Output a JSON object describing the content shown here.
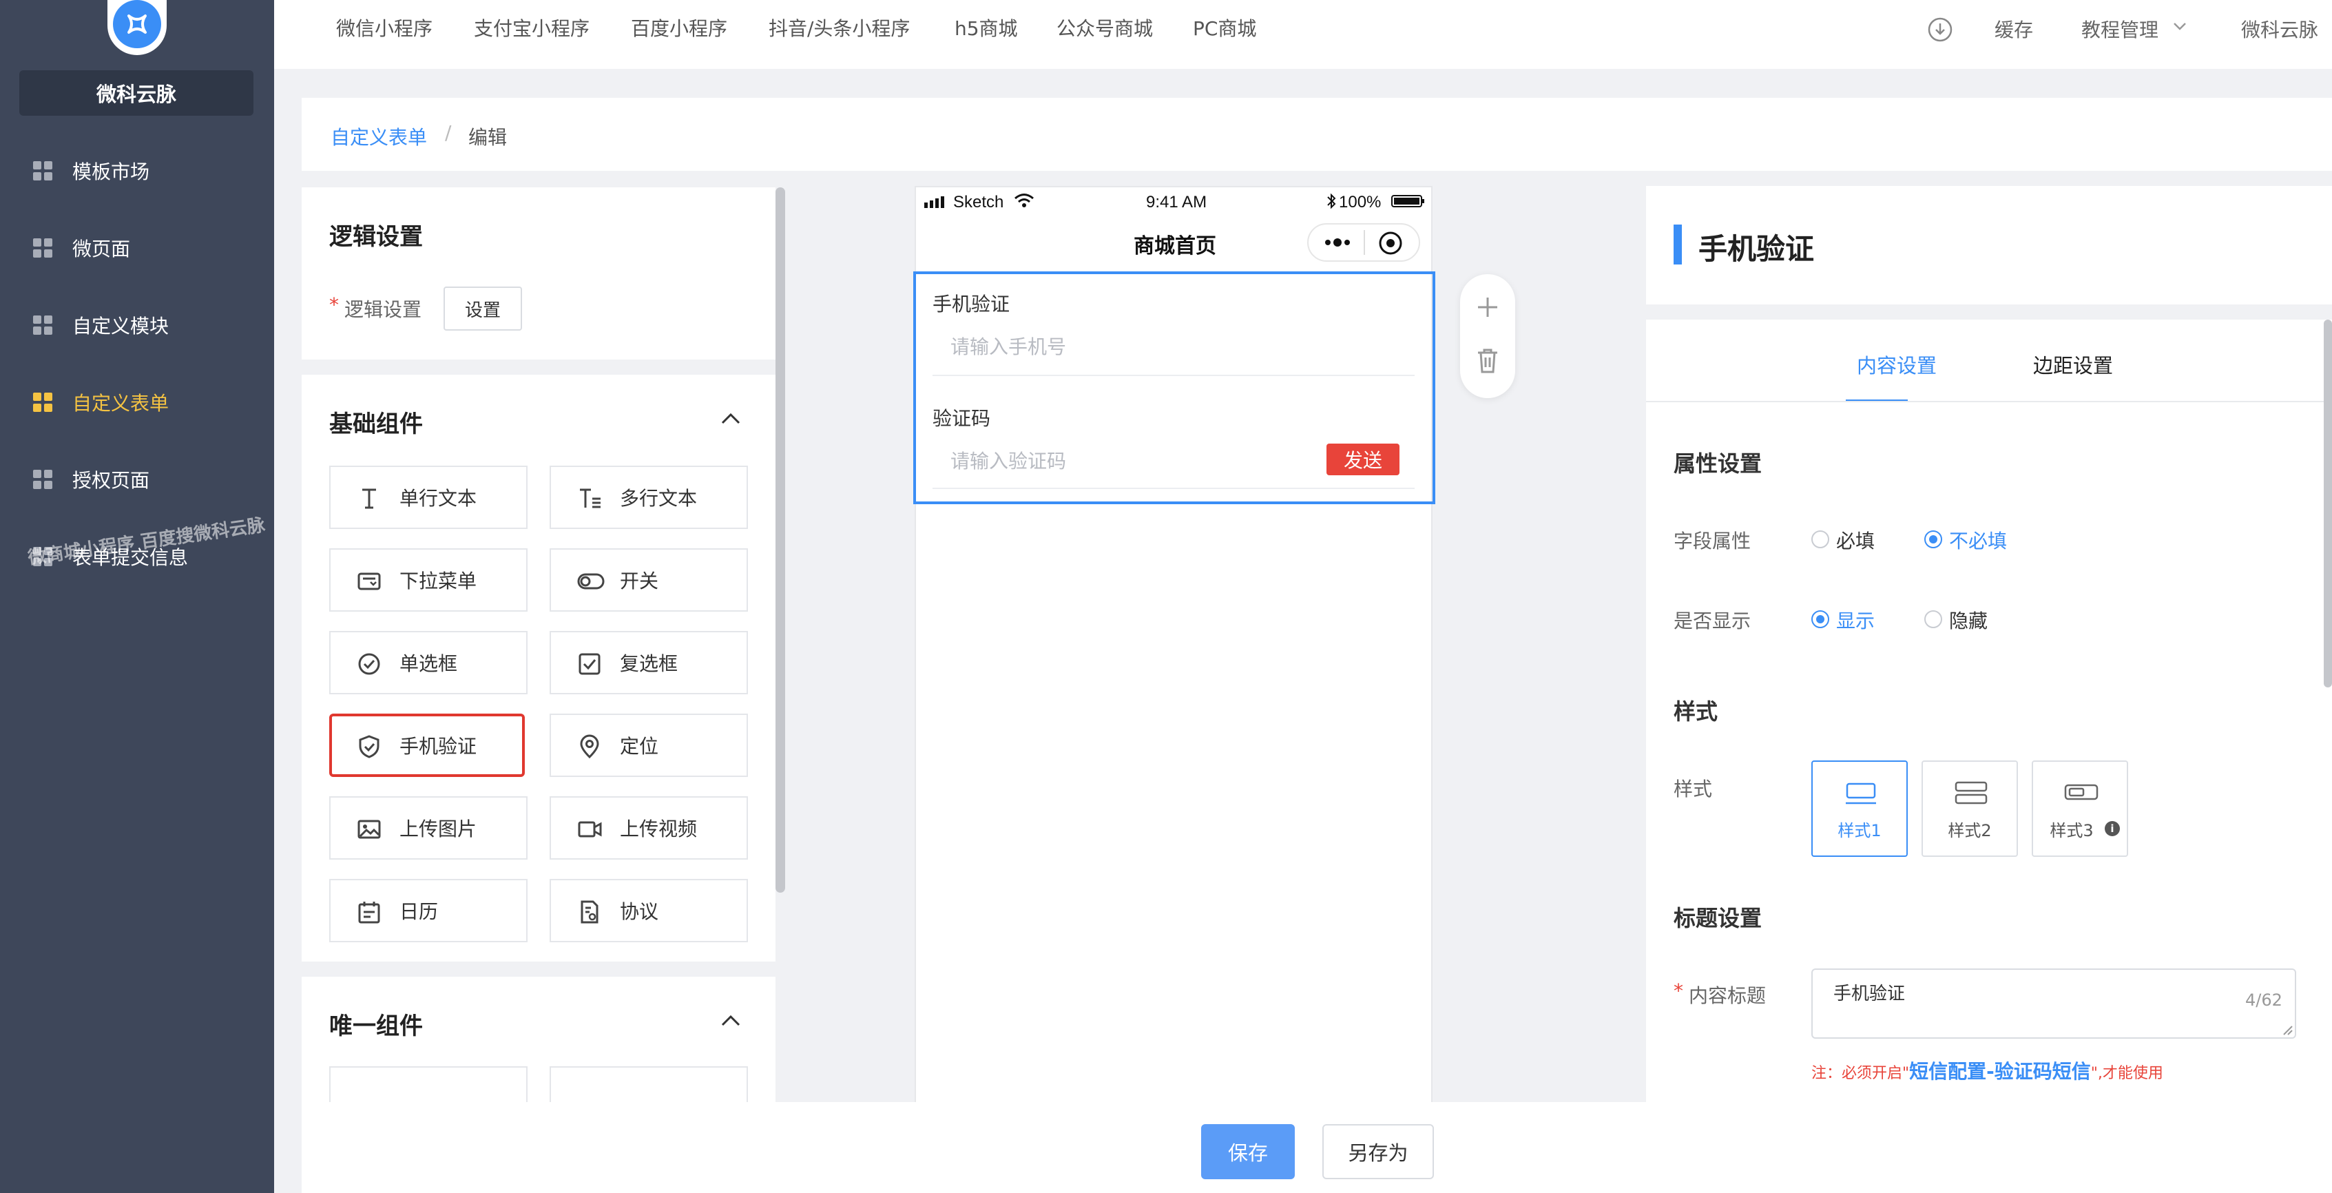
{
  "sidebar": {
    "brand": "微科云脉",
    "items": [
      {
        "label": "模板市场"
      },
      {
        "label": "微页面"
      },
      {
        "label": "自定义模块"
      },
      {
        "label": "自定义表单"
      },
      {
        "label": "授权页面"
      },
      {
        "label": "表单提交信息"
      }
    ],
    "active_index": 3,
    "watermark": "微商城小程序 百度搜微科云脉"
  },
  "topbar": {
    "nav": [
      "微信小程序",
      "支付宝小程序",
      "百度小程序",
      "抖音/头条小程序",
      "h5商城",
      "公众号商城",
      "PC商城"
    ],
    "cache": "缓存",
    "tutorial": "教程管理",
    "user": "微科云脉"
  },
  "breadcrumb": {
    "parent": "自定义表单",
    "separator": "/",
    "current": "编辑"
  },
  "logic": {
    "title": "逻辑设置",
    "required_mark": "*",
    "label": "逻辑设置",
    "button": "设置"
  },
  "basic_components": {
    "title": "基础组件",
    "items": [
      {
        "label": "单行文本",
        "icon": "text-cursor-icon"
      },
      {
        "label": "多行文本",
        "icon": "multiline-text-icon"
      },
      {
        "label": "下拉菜单",
        "icon": "dropdown-icon"
      },
      {
        "label": "开关",
        "icon": "toggle-icon"
      },
      {
        "label": "单选框",
        "icon": "radio-icon"
      },
      {
        "label": "复选框",
        "icon": "checkbox-icon"
      },
      {
        "label": "手机验证",
        "icon": "shield-icon"
      },
      {
        "label": "定位",
        "icon": "location-pin-icon"
      },
      {
        "label": "上传图片",
        "icon": "image-icon"
      },
      {
        "label": "上传视频",
        "icon": "video-icon"
      },
      {
        "label": "日历",
        "icon": "calendar-icon"
      },
      {
        "label": "协议",
        "icon": "agreement-icon"
      }
    ],
    "highlight_color": "#e0382f"
  },
  "unique_components": {
    "title": "唯一组件"
  },
  "phone": {
    "carrier": "Sketch",
    "time": "9:41 AM",
    "battery": "100%",
    "title": "商城首页",
    "phone_label": "手机验证",
    "phone_placeholder": "请输入手机号",
    "code_label": "验证码",
    "code_placeholder": "请输入验证码",
    "send": "发送"
  },
  "right": {
    "title": "手机验证",
    "tabs": [
      "内容设置",
      "边距设置"
    ],
    "active_tab": 0,
    "attr_heading": "属性设置",
    "field_attr": {
      "label": "字段属性",
      "options": [
        "必填",
        "不必填"
      ],
      "selected": 1
    },
    "display": {
      "label": "是否显示",
      "options": [
        "显示",
        "隐藏"
      ],
      "selected": 0
    },
    "style_heading": "样式",
    "style": {
      "label": "样式",
      "options": [
        "样式1",
        "样式2",
        "样式3"
      ],
      "selected": 0
    },
    "title_heading": "标题设置",
    "content_title": {
      "required_mark": "*",
      "label": "内容标题",
      "value": "手机验证",
      "counter": "4/62"
    },
    "note": {
      "prefix": "注：必须开启\"",
      "link": "短信配置-验证码短信",
      "suffix": "\",才能使用"
    }
  },
  "footer": {
    "save": "保存",
    "save_as": "另存为"
  },
  "colors": {
    "accent": "#3a8ef6",
    "sidebar": "#3e475a",
    "active_nav": "#f5c342",
    "danger": "#e8443a"
  }
}
